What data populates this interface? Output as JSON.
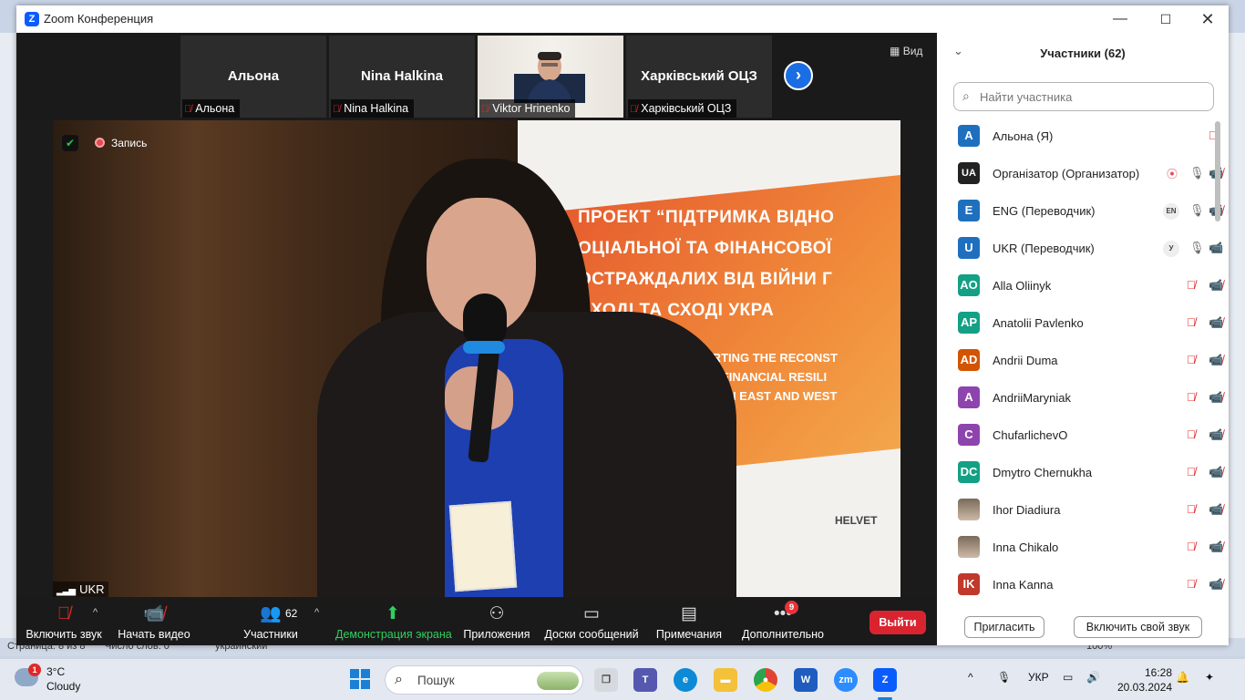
{
  "window": {
    "title": "Zoom Конференция",
    "logo_letter": "Z"
  },
  "thumbnails": [
    {
      "big_name": "Альона",
      "label": "Альона"
    },
    {
      "big_name": "Nina Halkina",
      "label": "Nina Halkina"
    },
    {
      "big_name": "",
      "label": "Viktor Hrinenko"
    },
    {
      "big_name": "Харківський ОЦЗ",
      "label": "Харківський ОЦЗ"
    }
  ],
  "view_label": "Вид",
  "recording_label": "Запись",
  "speaker_label": "UKR",
  "banner": {
    "line1": "ПРОЕКТ “ПІДТРИМКА ВІДНО",
    "line2": "ОЦІАЛЬНОЇ ТА ФІНАНСОВОЇ",
    "line3": "ОСТРАЖДАЛИХ ВІД ВІЙНИ Г",
    "line4": "АХОДІ ТА СХОДІ УКРА",
    "en1": "CT «SUPPORTING THE RECONST",
    "en2": "SOCIAL AND FINANCIAL RESILI",
    "en3": "OMMUNITIES IN EAST AND WEST",
    "logo": "HELVET"
  },
  "toolbar": {
    "audio": "Включить звук",
    "video": "Начать видео",
    "participants": "Участники",
    "participants_count": "62",
    "share": "Демонстрация экрана",
    "apps": "Приложения",
    "boards": "Доски сообщений",
    "notes": "Примечания",
    "more": "Дополнительно",
    "more_badge": "9",
    "exit": "Выйти"
  },
  "panel": {
    "title": "Участники (62)",
    "search_placeholder": "Найти участника",
    "participants": [
      {
        "initials": "A",
        "name": "Альона (Я)",
        "color": "#1f6fbf"
      },
      {
        "initials": "UA",
        "name": "Організатор (Организатор)",
        "color": "#222222"
      },
      {
        "initials": "E",
        "name": "ENG (Переводчик)",
        "color": "#1f6fbf",
        "lang": "EN"
      },
      {
        "initials": "U",
        "name": "UKR (Переводчик)",
        "color": "#1f6fbf",
        "lang": "У"
      },
      {
        "initials": "AO",
        "name": "Alla Oliinyk",
        "color": "#14a085"
      },
      {
        "initials": "AP",
        "name": "Anatolii Pavlenko",
        "color": "#14a085"
      },
      {
        "initials": "AD",
        "name": "Andrii Duma",
        "color": "#d35400"
      },
      {
        "initials": "A",
        "name": "AndriiMaryniak",
        "color": "#8e44ad"
      },
      {
        "initials": "C",
        "name": "ChufarlichevO",
        "color": "#8e44ad"
      },
      {
        "initials": "DC",
        "name": "Dmytro Chernukha",
        "color": "#14a085"
      },
      {
        "initials": "",
        "name": "Ihor Diadiura",
        "color": "#6b5a4a"
      },
      {
        "initials": "",
        "name": "Inna Chikalo",
        "color": "#c9b9a8"
      },
      {
        "initials": "IK",
        "name": "Inna Kanna",
        "color": "#c0392b"
      }
    ],
    "invite": "Пригласить",
    "unmute_self": "Включить свой звук"
  },
  "word_status": {
    "page": "Страница: 8 из 8",
    "words": "Число слов: 0",
    "lang": "украинский",
    "zoom": "100%"
  },
  "taskbar": {
    "weather_badge": "1",
    "temp": "3°C",
    "condition": "Cloudy",
    "search": "Пошук",
    "lang": "УКР",
    "time": "16:28",
    "date": "20.03.2024"
  }
}
